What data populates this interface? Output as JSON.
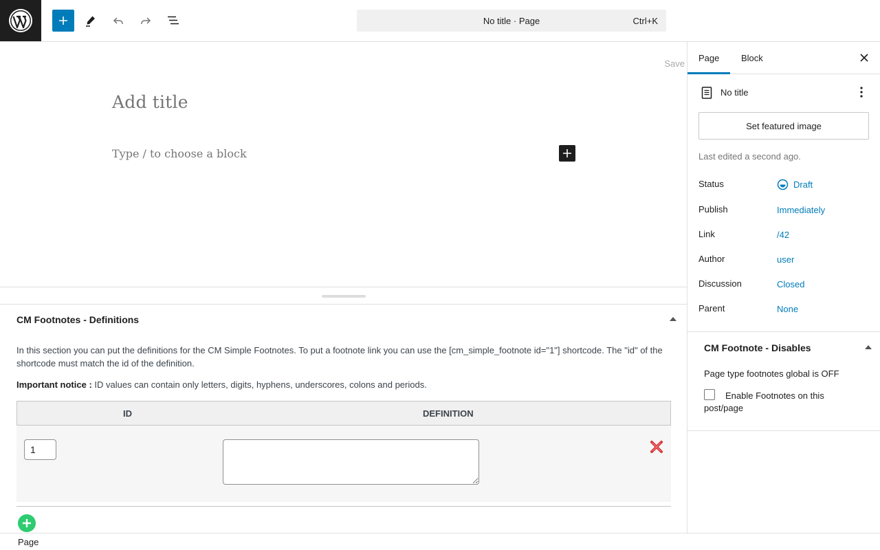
{
  "topbar": {
    "logo_icon": "wordpress-logo-icon",
    "doc_title": "No title · Page",
    "shortcut": "Ctrl+K"
  },
  "editor": {
    "save_label": "Save",
    "title_placeholder": "Add title",
    "block_placeholder": "Type / to choose a block"
  },
  "metabox": {
    "title": "CM Footnotes - Definitions",
    "description": "In this section you can put the definitions for the CM Simple Footnotes. To put a footnote link you can use the [cm_simple_footnote id=\"1\"] shortcode. The \"id\" of the shortcode must match the id of the definition.",
    "notice_label": "Important notice :",
    "notice_text": " ID values can contain only letters, digits, hyphens, underscores, colons and periods.",
    "table": {
      "headers": [
        "ID",
        "DEFINITION"
      ],
      "rows": [
        {
          "id": "1",
          "definition": ""
        }
      ]
    }
  },
  "footer": {
    "breadcrumb": "Page"
  },
  "sidebar": {
    "tabs": [
      {
        "label": "Page",
        "active": true
      },
      {
        "label": "Block",
        "active": false
      }
    ],
    "doc_title": "No title",
    "featured_image_label": "Set featured image",
    "last_edited": "Last edited a second ago.",
    "rows": [
      {
        "label": "Status",
        "value": "Draft"
      },
      {
        "label": "Publish",
        "value": "Immediately"
      },
      {
        "label": "Link",
        "value": "/42"
      },
      {
        "label": "Author",
        "value": "user"
      },
      {
        "label": "Discussion",
        "value": "Closed"
      },
      {
        "label": "Parent",
        "value": "None"
      }
    ],
    "panel": {
      "title": "CM Footnote - Disables",
      "text": "Page type footnotes global is OFF",
      "checkbox_label": "Enable Footnotes on this post/page",
      "checkbox_checked": false
    }
  },
  "colors": {
    "accent": "#007cba",
    "dark": "#1e1e1e",
    "add_green": "#2ecc71",
    "delete_red": "#d63638"
  }
}
